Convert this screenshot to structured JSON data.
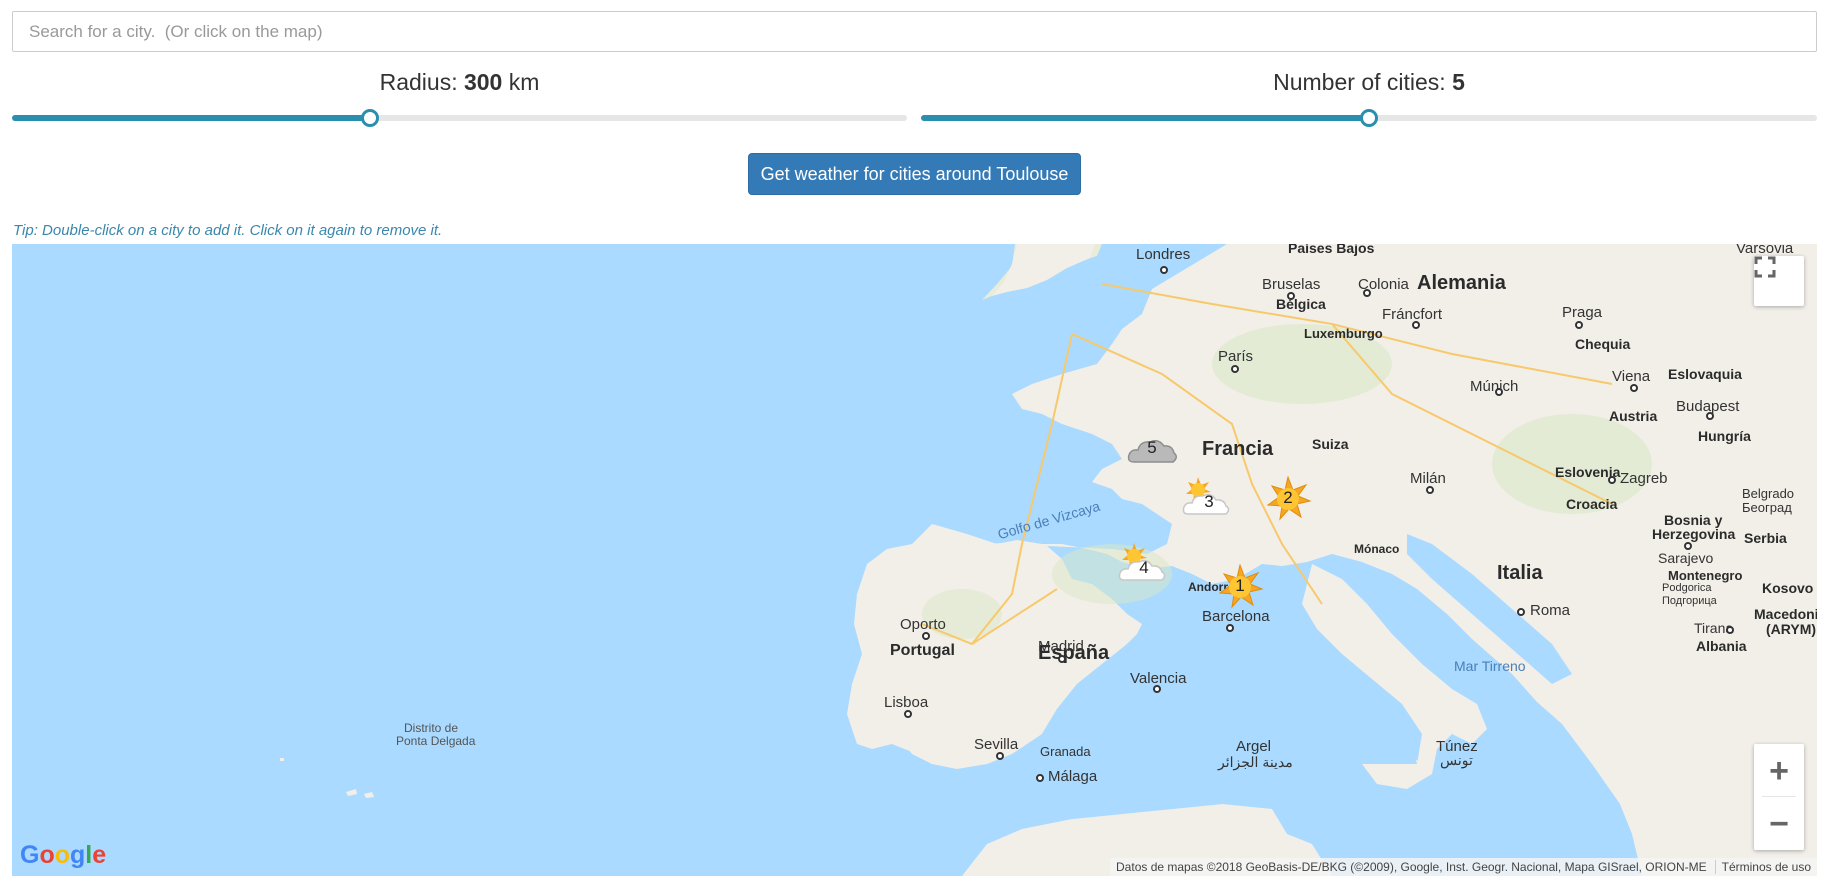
{
  "search": {
    "placeholder": "Search for a city.  (Or click on the map)",
    "value": ""
  },
  "radius": {
    "label": "Radius: ",
    "value": "300",
    "unit": " km",
    "level": 0.4
  },
  "cities": {
    "label": "Number of cities: ",
    "value": "5",
    "level": 0.5
  },
  "button": {
    "label": "Get weather for cities around Toulouse"
  },
  "tip": "Tip: Double-click on a city to add it. Click on it again to remove it.",
  "map": {
    "countries": {
      "alemania": "Alemania",
      "francia": "Francia",
      "espana": "España",
      "italia": "Italia",
      "portugal": "Portugal",
      "chequia": "Chequia",
      "eslovaquia": "Eslovaquia",
      "austria": "Austria",
      "hungria": "Hungría",
      "suiza": "Suiza",
      "eslovenia": "Eslovenia",
      "croacia": "Croacia",
      "bosnia": "Bosnia y",
      "herzegovina": "Herzegovina",
      "serbia": "Serbia",
      "montenegro": "Montenegro",
      "kosovo": "Kosovo",
      "macedonia": "Macedonia",
      "arym": "(ARYM)",
      "albania": "Albania",
      "belgica": "Bélgica",
      "luxemburgo": "Luxemburgo",
      "paises_bajos": "Países Bajos",
      "monaco": "Mónaco",
      "andorra": "Andorra"
    },
    "cities": {
      "londres": "Londres",
      "bruselas": "Bruselas",
      "colonia": "Colonia",
      "francfort": "Fráncfort",
      "praga": "Praga",
      "varsovia": "Varsovia",
      "paris": "París",
      "munich": "Múnich",
      "viena": "Viena",
      "budapest": "Budapest",
      "milan": "Milán",
      "zagreb": "Zagreb",
      "belgrado": "Belgrado",
      "belgrado_cyr": "Београд",
      "sarajevo": "Sarajevo",
      "podgorica": "Podgorica",
      "podgorica_cyr": "Подгорица",
      "roma": "Roma",
      "tirana": "Tirana",
      "barcelona": "Barcelona",
      "oporto": "Oporto",
      "madrid": "Madrid",
      "valencia": "Valencia",
      "lisboa": "Lisboa",
      "sevilla": "Sevilla",
      "granada": "Granada",
      "malaga": "Málaga",
      "argel": "Argel",
      "argel_ar": "مدينة الجزائر",
      "tunez": "Túnez",
      "tunez_ar": "تونس",
      "ponta_delgada_1": "Distrito de",
      "ponta_delgada_2": "Ponta Delgada"
    },
    "seas": {
      "vizcaya": "Golfo de Vizcaya",
      "tirreno": "Mar Tirreno"
    },
    "markers": [
      {
        "number": "1",
        "weather": "sunny"
      },
      {
        "number": "2",
        "weather": "sunny"
      },
      {
        "number": "3",
        "weather": "partly-cloudy"
      },
      {
        "number": "4",
        "weather": "partly-cloudy"
      },
      {
        "number": "5",
        "weather": "cloudy"
      }
    ],
    "controls": {
      "fullscreen_icon": "fullscreen-icon",
      "zoom_in": "+",
      "zoom_out": "−"
    },
    "attribution": "Datos de mapas ©2018 GeoBasis-DE/BKG (©2009), Google, Inst. Geogr. Nacional, Mapa GISrael, ORION-ME",
    "terms": "Términos de uso",
    "logo": "Google",
    "colors": {
      "water": "#aadaff",
      "land": "#f2efe9",
      "slider": "#2a8fae",
      "button": "#337ab7",
      "tip": "#3a87ad"
    }
  }
}
